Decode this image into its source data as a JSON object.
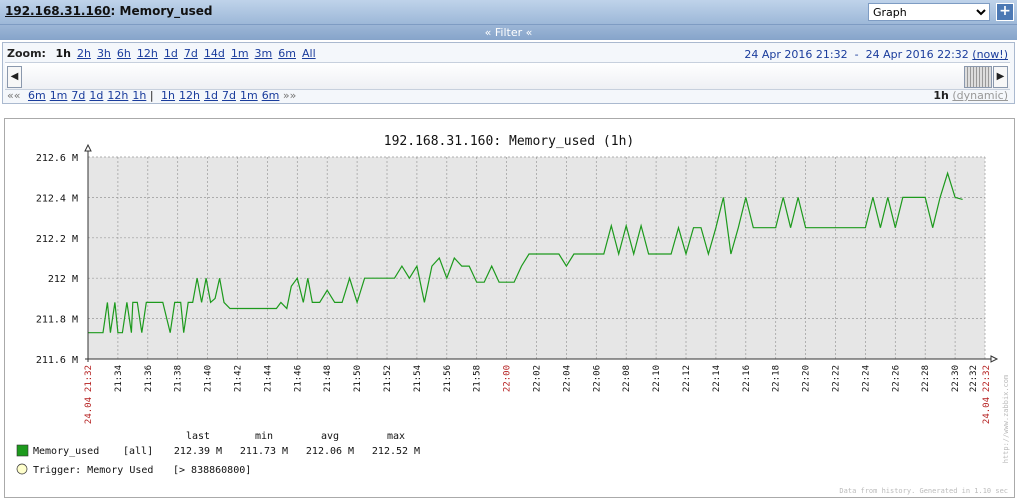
{
  "header": {
    "host": "192.168.31.160",
    "separator": ":",
    "item": "Memory_used",
    "view_select": "Graph",
    "plus_icon": "+"
  },
  "filter_bar": {
    "label": "Filter",
    "icon_left": "«",
    "icon_right": "«"
  },
  "zoom": {
    "label": "Zoom:",
    "options": [
      "1h",
      "2h",
      "3h",
      "6h",
      "12h",
      "1d",
      "7d",
      "14d",
      "1m",
      "3m",
      "6m",
      "All"
    ],
    "selected": "1h"
  },
  "period": {
    "from": "24 Apr 2016 21:32",
    "dash": "-",
    "to": "24 Apr 2016 22:32",
    "now": "(now!)"
  },
  "steps": {
    "back_icon": "««",
    "back": [
      "6m",
      "1m",
      "7d",
      "1d",
      "12h",
      "1h"
    ],
    "divider": "|",
    "forward": [
      "1h",
      "12h",
      "1d",
      "7d",
      "1m",
      "6m"
    ],
    "fwd_icon": "»»"
  },
  "dynamic": {
    "period": "1h",
    "mode": "(dynamic)"
  },
  "graph": {
    "title": "192.168.31.160: Memory_used (1h)",
    "colors": {
      "series": "#1d9a1d",
      "trigger_fill": "#ffffcc",
      "grid": "#999999",
      "plot_bg": "#e6e6e6",
      "date_label": "#b52020"
    },
    "legend": {
      "headers": [
        "last",
        "min",
        "avg",
        "max"
      ],
      "series_name": "Memory_used",
      "series_tag": "[all]",
      "series_values": [
        "212.39 M",
        "211.73 M",
        "212.06 M",
        "212.52 M"
      ],
      "trigger": "Trigger: Memory Used",
      "trigger_cond": "[> 838860800]"
    },
    "watermark_right": "http://www.zabbix.com",
    "footer_note": "Data from history. Generated in 1.10 sec"
  },
  "chart_data": {
    "type": "line",
    "title": "192.168.31.160: Memory_used (1h)",
    "xlabel": "",
    "ylabel": "",
    "ylim": [
      211.6,
      212.6
    ],
    "yticks": [
      "211.6 M",
      "211.8 M",
      "212 M",
      "212.2 M",
      "212.4 M",
      "212.6 M"
    ],
    "xticks": [
      "21:32",
      "21:34",
      "21:36",
      "21:38",
      "21:40",
      "21:42",
      "21:44",
      "21:46",
      "21:48",
      "21:50",
      "21:52",
      "21:54",
      "21:56",
      "21:58",
      "22:00",
      "22:02",
      "22:04",
      "22:06",
      "22:08",
      "22:10",
      "22:12",
      "22:14",
      "22:16",
      "22:18",
      "22:20",
      "22:22",
      "22:24",
      "22:26",
      "22:28",
      "22:30",
      "22:32",
      "22:32"
    ],
    "xtick_dates": {
      "first": "24.04",
      "last": "24.04"
    },
    "grid": true,
    "series": [
      {
        "name": "Memory_used",
        "x_minutes": [
          0,
          0.8,
          1.0,
          1.3,
          1.5,
          1.8,
          2.0,
          2.3,
          2.6,
          2.9,
          3.0,
          3.3,
          3.6,
          3.9,
          4.2,
          4.5,
          5.0,
          5.5,
          5.8,
          6.0,
          6.2,
          6.4,
          6.7,
          7.0,
          7.3,
          7.6,
          7.9,
          8.2,
          8.5,
          8.8,
          9.1,
          9.5,
          9.8,
          10.2,
          10.5,
          11.0,
          11.5,
          11.8,
          12.0,
          12.3,
          12.6,
          12.9,
          13.3,
          13.6,
          14.0,
          14.4,
          14.7,
          15.0,
          15.5,
          16.0,
          16.5,
          17.0,
          17.5,
          18.0,
          18.5,
          19.0,
          19.5,
          20.0,
          20.5,
          21.0,
          21.5,
          22.0,
          22.5,
          23.0,
          23.5,
          24.0,
          24.5,
          25.0,
          25.5,
          26.0,
          26.5,
          27.0,
          27.5,
          28.0,
          28.5,
          29.0,
          29.5,
          30.0,
          30.5,
          31.0,
          31.5,
          32.0,
          32.5,
          33.0,
          33.5,
          34.0,
          34.5,
          35.0,
          35.5,
          36.0,
          36.5,
          37.0,
          37.5,
          38.0,
          38.5,
          39.0,
          39.5,
          40.0,
          40.5,
          41.0,
          41.5,
          42.0,
          42.5,
          43.0,
          43.5,
          44.0,
          44.5,
          45.0,
          45.5,
          46.0,
          46.5,
          47.0,
          47.5,
          48.0,
          48.5,
          49.0,
          49.5,
          50.0,
          50.5,
          51.0,
          51.5,
          52.0,
          52.5,
          53.0,
          53.5,
          54.0,
          54.5,
          55.0,
          55.5,
          56.0,
          56.5,
          57.0,
          57.5,
          58.0,
          58.5,
          59.0,
          59.3,
          59.6,
          60.0
        ],
        "values": [
          211.73,
          211.73,
          211.73,
          211.88,
          211.73,
          211.88,
          211.73,
          211.73,
          211.88,
          211.73,
          211.88,
          211.88,
          211.73,
          211.88,
          211.88,
          211.88,
          211.88,
          211.73,
          211.88,
          211.88,
          211.88,
          211.73,
          211.88,
          211.88,
          212.0,
          211.88,
          212.0,
          211.88,
          211.9,
          212.0,
          211.88,
          211.85,
          211.85,
          211.85,
          211.85,
          211.85,
          211.85,
          211.85,
          211.85,
          211.85,
          211.85,
          211.88,
          211.85,
          211.96,
          212.0,
          211.88,
          212.0,
          211.88,
          211.88,
          211.94,
          211.88,
          211.88,
          212.0,
          211.88,
          212.0,
          212.0,
          212.0,
          212.0,
          212.0,
          212.06,
          212.0,
          212.06,
          211.88,
          212.06,
          212.1,
          212.0,
          212.1,
          212.06,
          212.06,
          211.98,
          211.98,
          212.06,
          211.98,
          211.98,
          211.98,
          212.06,
          212.12,
          212.12,
          212.12,
          212.12,
          212.12,
          212.06,
          212.12,
          212.12,
          212.12,
          212.12,
          212.12,
          212.26,
          212.12,
          212.26,
          212.12,
          212.26,
          212.12,
          212.12,
          212.12,
          212.12,
          212.25,
          212.12,
          212.25,
          212.25,
          212.12,
          212.25,
          212.4,
          212.12,
          212.25,
          212.4,
          212.25,
          212.25,
          212.25,
          212.25,
          212.4,
          212.25,
          212.4,
          212.25,
          212.25,
          212.25,
          212.25,
          212.25,
          212.25,
          212.25,
          212.25,
          212.25,
          212.4,
          212.25,
          212.4,
          212.25,
          212.4,
          212.4,
          212.4,
          212.4,
          212.25,
          212.4,
          212.52,
          212.4,
          212.39
        ]
      }
    ]
  }
}
